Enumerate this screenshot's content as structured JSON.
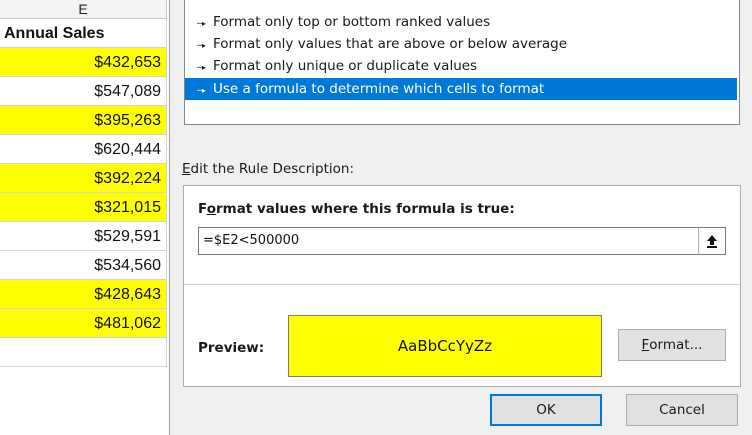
{
  "sheet": {
    "column_letter": "E",
    "header": "Annual Sales",
    "highlight_color": "#ffff00",
    "rows": [
      {
        "value": "$432,653",
        "highlighted": true
      },
      {
        "value": "$547,089",
        "highlighted": false
      },
      {
        "value": "$395,263",
        "highlighted": true
      },
      {
        "value": "$620,444",
        "highlighted": false
      },
      {
        "value": "$392,224",
        "highlighted": true
      },
      {
        "value": "$321,015",
        "highlighted": true
      },
      {
        "value": "$529,591",
        "highlighted": false
      },
      {
        "value": "$534,560",
        "highlighted": false
      },
      {
        "value": "$428,643",
        "highlighted": true
      },
      {
        "value": "$481,062",
        "highlighted": true
      },
      {
        "value": "",
        "highlighted": false
      }
    ]
  },
  "dialog": {
    "rule_types": [
      {
        "label": "Format only top or bottom ranked values",
        "selected": false
      },
      {
        "label": "Format only values that are above or below average",
        "selected": false
      },
      {
        "label": "Format only unique or duplicate values",
        "selected": false
      },
      {
        "label": "Use a formula to determine which cells to format",
        "selected": true
      }
    ],
    "edit_label_access": "E",
    "edit_label_rest": "dit the Rule Description:",
    "formula_label_access": "o",
    "formula_label_pre": "F",
    "formula_label_rest": "rmat values where this formula is true:",
    "formula_value": "=$E2<500000",
    "preview_label": "Preview:",
    "preview_text": "AaBbCcYyZz",
    "preview_fill": "#ffff00",
    "format_button_access": "F",
    "format_button_rest": "ormat...",
    "ok_label": "OK",
    "cancel_label": "Cancel",
    "selection_color": "#0078d7",
    "collapse_icon": "upload-arrow-icon"
  }
}
